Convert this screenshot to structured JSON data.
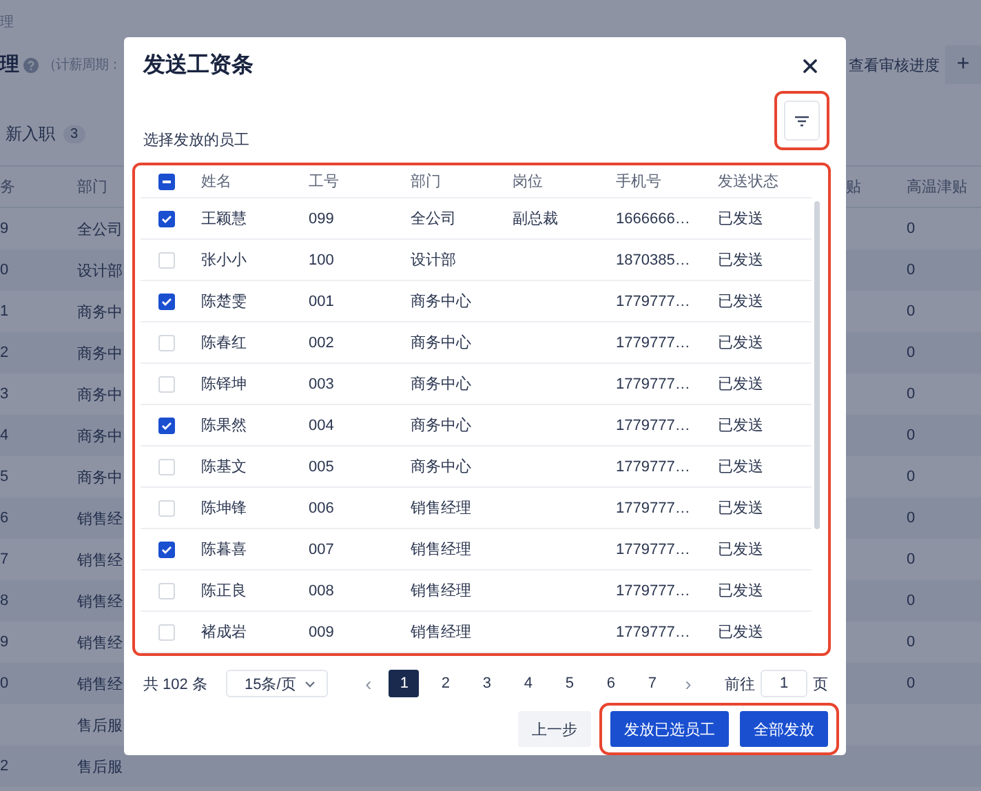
{
  "background": {
    "breadcrumb": "理",
    "title": "理",
    "cycle_label": "（计薪周期：",
    "actions": [
      {
        "label": "查看审核进度",
        "kind": "text"
      },
      {
        "label": "+",
        "kind": "icon"
      }
    ],
    "tabs": [
      {
        "label": "新入职",
        "count": "3",
        "selected": false
      }
    ],
    "table": {
      "columns": [
        "务",
        "部门",
        "贴",
        "高温津贴"
      ],
      "rows": [
        {
          "cells": [
            "9",
            "全公司",
            null,
            "0"
          ]
        },
        {
          "cells": [
            "0",
            "设计部",
            null,
            "0"
          ]
        },
        {
          "cells": [
            "1",
            "商务中",
            null,
            "0"
          ]
        },
        {
          "cells": [
            "2",
            "商务中",
            null,
            "0"
          ]
        },
        {
          "cells": [
            "3",
            "商务中",
            null,
            "0"
          ]
        },
        {
          "cells": [
            "4",
            "商务中",
            null,
            "0"
          ]
        },
        {
          "cells": [
            "5",
            "商务中",
            null,
            "0"
          ]
        },
        {
          "cells": [
            "6",
            "销售经",
            null,
            "0"
          ]
        },
        {
          "cells": [
            "7",
            "销售经",
            null,
            "0"
          ]
        },
        {
          "cells": [
            "8",
            "销售经",
            null,
            "0"
          ]
        },
        {
          "cells": [
            "9",
            "销售经",
            null,
            "0"
          ]
        },
        {
          "cells": [
            "0",
            "销售经",
            null,
            "0"
          ]
        },
        {
          "cells": [
            null,
            "售后服",
            null,
            null
          ]
        },
        {
          "cells": [
            "2",
            "售后服",
            null,
            null
          ]
        }
      ]
    }
  },
  "dialog": {
    "title": "发送工资条",
    "filter_highlighted": true,
    "section_label": "选择发放的员工",
    "table": {
      "highlighted": true,
      "select_all_partial": true,
      "columns": [
        "姓名",
        "工号",
        "部门",
        "岗位",
        "手机号",
        "发送状态"
      ],
      "rows": [
        {
          "checked": true,
          "cells": [
            "王颖慧",
            "099",
            "全公司",
            "副总裁",
            "1666666…",
            "已发送"
          ]
        },
        {
          "checked": false,
          "cells": [
            "张小小",
            "100",
            "设计部",
            null,
            "1870385…",
            "已发送"
          ]
        },
        {
          "checked": true,
          "cells": [
            "陈楚雯",
            "001",
            "商务中心",
            null,
            "1779777…",
            "已发送"
          ]
        },
        {
          "checked": false,
          "cells": [
            "陈春红",
            "002",
            "商务中心",
            null,
            "1779777…",
            "已发送"
          ]
        },
        {
          "checked": false,
          "cells": [
            "陈铎坤",
            "003",
            "商务中心",
            null,
            "1779777…",
            "已发送"
          ]
        },
        {
          "checked": true,
          "cells": [
            "陈果然",
            "004",
            "商务中心",
            null,
            "1779777…",
            "已发送"
          ]
        },
        {
          "checked": false,
          "cells": [
            "陈基文",
            "005",
            "商务中心",
            null,
            "1779777…",
            "已发送"
          ]
        },
        {
          "checked": false,
          "cells": [
            "陈坤锋",
            "006",
            "销售经理",
            null,
            "1779777…",
            "已发送"
          ]
        },
        {
          "checked": true,
          "cells": [
            "陈暮喜",
            "007",
            "销售经理",
            null,
            "1779777…",
            "已发送"
          ]
        },
        {
          "checked": false,
          "cells": [
            "陈正良",
            "008",
            "销售经理",
            null,
            "1779777…",
            "已发送"
          ]
        },
        {
          "checked": false,
          "cells": [
            "褚成岩",
            "009",
            "销售经理",
            null,
            "1779777…",
            "已发送"
          ]
        }
      ]
    },
    "pagination": {
      "total": "共 102 条",
      "page_size": "15条/页",
      "prev": "‹",
      "next": "›",
      "pages": [
        {
          "label": "1",
          "selected": true
        },
        {
          "label": "2",
          "selected": false
        },
        {
          "label": "3",
          "selected": false
        },
        {
          "label": "4",
          "selected": false
        },
        {
          "label": "5",
          "selected": false
        },
        {
          "label": "6",
          "selected": false
        },
        {
          "label": "7",
          "selected": false
        }
      ],
      "goto_label": "前往",
      "goto_value": "1",
      "goto_unit": "页"
    },
    "buttons": [
      {
        "label": "上一步",
        "kind": "secondary",
        "highlighted": false
      },
      {
        "label": "发放已选员工",
        "kind": "primary",
        "highlighted": true
      },
      {
        "label": "全部发放",
        "kind": "primary",
        "highlighted": true
      }
    ]
  }
}
